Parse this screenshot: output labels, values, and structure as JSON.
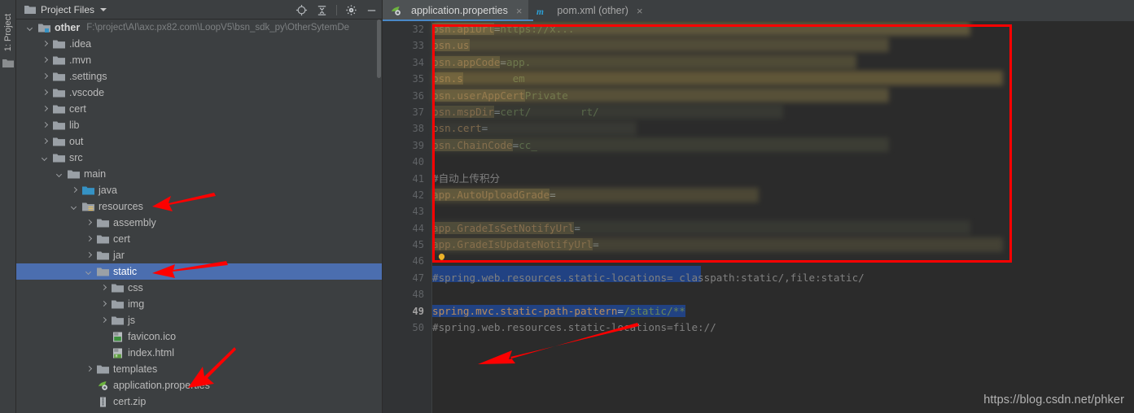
{
  "window": {
    "left_strip_label": "1: Project",
    "left_strip_icon": "folder-icon"
  },
  "project_panel": {
    "title": "Project Files",
    "title_icon": "folder-icon",
    "dropdown_icon": "chevron-down-icon",
    "tools": [
      {
        "name": "locate-icon",
        "label": "Select Opened File"
      },
      {
        "name": "collapse-all-icon",
        "label": "Collapse All"
      },
      {
        "name": "gear-icon",
        "label": "Settings"
      },
      {
        "name": "minimize-icon",
        "label": "Hide"
      }
    ],
    "tree": [
      {
        "label": "other",
        "path": "F:\\project\\AI\\axc.px82.com\\LoopV5\\bsn_sdk_py\\OtherSytemDe",
        "indent": 0,
        "arrow": "down",
        "icon": "module-folder-icon",
        "root": true
      },
      {
        "label": ".idea",
        "indent": 1,
        "arrow": "right",
        "icon": "folder-icon"
      },
      {
        "label": ".mvn",
        "indent": 1,
        "arrow": "right",
        "icon": "folder-icon"
      },
      {
        "label": ".settings",
        "indent": 1,
        "arrow": "right",
        "icon": "folder-icon"
      },
      {
        "label": ".vscode",
        "indent": 1,
        "arrow": "right",
        "icon": "folder-icon"
      },
      {
        "label": "cert",
        "indent": 1,
        "arrow": "right",
        "icon": "folder-icon"
      },
      {
        "label": "lib",
        "indent": 1,
        "arrow": "right",
        "icon": "folder-icon"
      },
      {
        "label": "out",
        "indent": 1,
        "arrow": "right",
        "icon": "folder-icon"
      },
      {
        "label": "src",
        "indent": 1,
        "arrow": "down",
        "icon": "folder-icon"
      },
      {
        "label": "main",
        "indent": 2,
        "arrow": "down",
        "icon": "folder-icon"
      },
      {
        "label": "java",
        "indent": 3,
        "arrow": "right",
        "icon": "source-folder-icon"
      },
      {
        "label": "resources",
        "indent": 3,
        "arrow": "down",
        "icon": "resources-folder-icon"
      },
      {
        "label": "assembly",
        "indent": 4,
        "arrow": "right",
        "icon": "folder-icon"
      },
      {
        "label": "cert",
        "indent": 4,
        "arrow": "right",
        "icon": "folder-icon"
      },
      {
        "label": "jar",
        "indent": 4,
        "arrow": "right",
        "icon": "folder-icon"
      },
      {
        "label": "static",
        "indent": 4,
        "arrow": "down",
        "icon": "folder-icon",
        "selected": true
      },
      {
        "label": "css",
        "indent": 5,
        "arrow": "right",
        "icon": "folder-icon"
      },
      {
        "label": "img",
        "indent": 5,
        "arrow": "right",
        "icon": "folder-icon"
      },
      {
        "label": "js",
        "indent": 5,
        "arrow": "right",
        "icon": "folder-icon"
      },
      {
        "label": "favicon.ico",
        "indent": 5,
        "arrow": "none",
        "icon": "image-file-icon"
      },
      {
        "label": "index.html",
        "indent": 5,
        "arrow": "none",
        "icon": "html-file-icon"
      },
      {
        "label": "templates",
        "indent": 4,
        "arrow": "right",
        "icon": "folder-icon"
      },
      {
        "label": "application.properties",
        "indent": 4,
        "arrow": "none",
        "icon": "spring-properties-icon"
      },
      {
        "label": "cert.zip",
        "indent": 4,
        "arrow": "none",
        "icon": "zip-file-icon"
      }
    ]
  },
  "editor": {
    "tabs": [
      {
        "label": "application.properties",
        "icon": "spring-properties-icon",
        "active": true,
        "close": "×"
      },
      {
        "label": "pom.xml (other)",
        "icon": "maven-icon",
        "active": false,
        "close": "×"
      }
    ],
    "line_numbers": [
      "32",
      "33",
      "34",
      "35",
      "36",
      "37",
      "38",
      "39",
      "40",
      "41",
      "42",
      "43",
      "44",
      "45",
      "46",
      "47",
      "48",
      "49",
      "50"
    ],
    "current_line": "49",
    "lines": [
      {
        "num": "32",
        "key": "bsn.apiUrl",
        "eq": "=",
        "value": "https://x...",
        "redacted": true
      },
      {
        "num": "33",
        "key": "bsn.us",
        "eq": "",
        "value": "",
        "redacted": true
      },
      {
        "num": "34",
        "key": "bsn.appCode",
        "eq": "=",
        "value": "app.",
        "redacted": true
      },
      {
        "num": "35",
        "key": "bsn.s",
        "eq": "",
        "value": "",
        "redacted": true,
        "tail": "em"
      },
      {
        "num": "36",
        "key": "bsn.userAppCert",
        "eq": "",
        "value": "Private",
        "redacted": true
      },
      {
        "num": "37",
        "key": "bsn.mspDir",
        "eq": "=",
        "value": "cert/",
        "redacted": true,
        "tail": "rt/"
      },
      {
        "num": "38",
        "key": "bsn.cert",
        "eq": "=",
        "value": "",
        "redacted": false
      },
      {
        "num": "39",
        "key": "bsn.ChainCode",
        "eq": "=",
        "value": "cc_",
        "redacted": true
      },
      {
        "num": "40",
        "key": "",
        "eq": "",
        "value": ""
      },
      {
        "num": "41",
        "comment": "#自动上传积分"
      },
      {
        "num": "42",
        "key": "app.AutoUploadGrade",
        "eq": "=",
        "value": "",
        "redacted": true
      },
      {
        "num": "43",
        "key": "",
        "eq": "",
        "value": ""
      },
      {
        "num": "44",
        "key": "app.GradeIsSetNotifyUrl",
        "eq": "=",
        "value": "",
        "redacted": true
      },
      {
        "num": "45",
        "key": "app.GradeIsUpdateNotifyUrl",
        "eq": "=",
        "value": "",
        "redacted": true
      },
      {
        "num": "46",
        "key": "",
        "eq": "",
        "value": ""
      },
      {
        "num": "47",
        "comment": "#spring.web.resources.static-locations= classpath:static/,file:static/"
      },
      {
        "num": "48",
        "key": "",
        "eq": "",
        "value": "",
        "bulb": true
      },
      {
        "num": "49",
        "key": "spring.mvc.static-path-pattern",
        "eq": "=",
        "value": "/static/**",
        "highlight": true
      },
      {
        "num": "50",
        "comment": "#spring.web.resources.static-locations=file://"
      }
    ]
  },
  "annotations": {
    "red_box": {
      "label": "highlighted-config-block"
    },
    "arrows": [
      {
        "name": "arrow-to-resources"
      },
      {
        "name": "arrow-to-static"
      },
      {
        "name": "arrow-to-application-properties"
      },
      {
        "name": "arrow-to-static-path-pattern"
      }
    ]
  },
  "watermark": "https://blog.csdn.net/phker",
  "colors": {
    "accent_selection": "#4b6eaf",
    "annotation_red": "#fe0000",
    "tab_underline": "#4a88c7",
    "editor_bg": "#2b2b2b",
    "panel_bg": "#3c3f41"
  }
}
